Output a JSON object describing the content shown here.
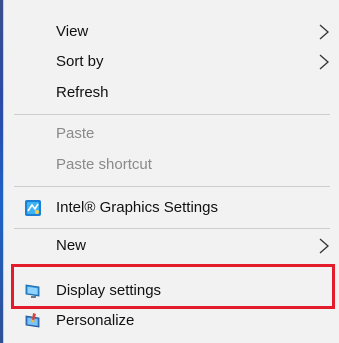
{
  "menu": {
    "groups": [
      {
        "items": [
          {
            "label": "View",
            "has_submenu": true,
            "disabled": false
          },
          {
            "label": "Sort by",
            "has_submenu": true,
            "disabled": false
          },
          {
            "label": "Refresh",
            "has_submenu": false,
            "disabled": false
          }
        ]
      },
      {
        "items": [
          {
            "label": "Paste",
            "has_submenu": false,
            "disabled": true
          },
          {
            "label": "Paste shortcut",
            "has_submenu": false,
            "disabled": true
          }
        ]
      },
      {
        "items": [
          {
            "label": "Intel® Graphics Settings",
            "has_submenu": false,
            "disabled": false,
            "icon": "intel-graphics-icon"
          }
        ]
      },
      {
        "items": [
          {
            "label": "New",
            "has_submenu": true,
            "disabled": false
          }
        ]
      },
      {
        "items": [
          {
            "label": "Display settings",
            "has_submenu": false,
            "disabled": false,
            "icon": "display-monitor-icon",
            "highlighted": true
          },
          {
            "label": "Personalize",
            "has_submenu": false,
            "disabled": false,
            "icon": "personalize-icon"
          }
        ]
      }
    ]
  },
  "colors": {
    "menu_background": "#f2f2f2",
    "text": "#111111",
    "disabled_text": "#8a8a8a",
    "separator": "#cdcdcd",
    "highlight_border": "#e41b2b"
  }
}
